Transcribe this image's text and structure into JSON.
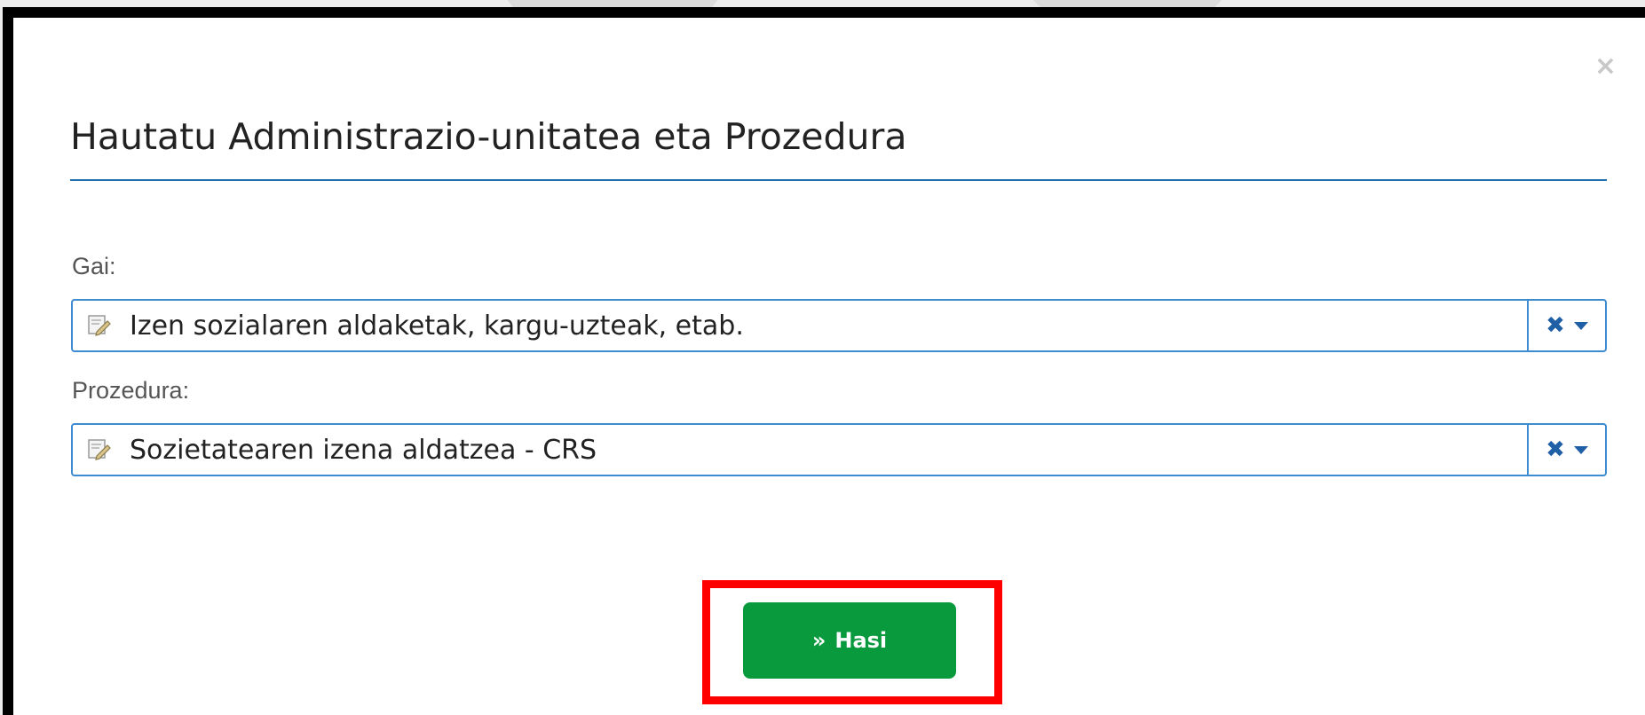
{
  "modal": {
    "title": "Hautatu Administrazio-unitatea eta Prozedura",
    "close_symbol": "×",
    "close_icon": "close-icon"
  },
  "fields": {
    "gai": {
      "label": "Gai:",
      "value": "Izen sozialaren aldaketak, kargu-uzteak, etab.",
      "icon": "document-edit-icon",
      "clear_symbol": "✖"
    },
    "prozedura": {
      "label": "Prozedura:",
      "value": "Sozietatearen izena aldatzea - CRS",
      "icon": "document-edit-icon",
      "clear_symbol": "✖"
    }
  },
  "start_button": {
    "icon": "»",
    "label": "Hasi"
  },
  "colors": {
    "accent": "#1f6fae",
    "button": "#0a9a3e",
    "highlight": "#ff0000",
    "modal_border": "#000000"
  }
}
